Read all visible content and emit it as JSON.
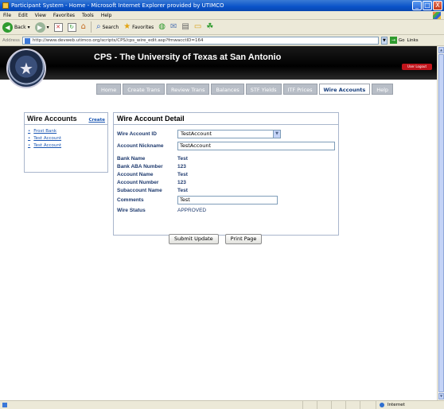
{
  "window": {
    "title": "Participant System - Home - Microsoft Internet Explorer provided by UTIMCO",
    "controls": [
      "_",
      "□",
      "X"
    ]
  },
  "menu": [
    "File",
    "Edit",
    "View",
    "Favorites",
    "Tools",
    "Help"
  ],
  "toolbar": {
    "back_label": "Back",
    "search_label": "Search",
    "favorites_label": "Favorites"
  },
  "address": {
    "label": "Address",
    "url": "http://www.devweb.utimco.org/scripts/CPS/cps_wire_edit.asp?fmwacctID=164",
    "go_label": "Go",
    "links_label": "Links"
  },
  "banner": {
    "title": "CPS - The University of Texas at San Antonio",
    "logout_label": "User Logout"
  },
  "tabs": [
    {
      "label": "Home"
    },
    {
      "label": "Create Trans"
    },
    {
      "label": "Review Trans"
    },
    {
      "label": "Balances"
    },
    {
      "label": "STF Yields"
    },
    {
      "label": "ITF Prices"
    },
    {
      "label": "Wire Accounts",
      "active": true
    },
    {
      "label": "Help"
    }
  ],
  "wire_accounts": {
    "title": "Wire Accounts",
    "create_label": "Create",
    "items": [
      "Frost Bank",
      "Test Account",
      "Test Account"
    ]
  },
  "detail": {
    "title": "Wire Account Detail",
    "wire_account_id_label": "Wire Account ID",
    "wire_account_id_value": "TestAccount",
    "nickname_label": "Account Nickname",
    "nickname_value": "TestAccount",
    "bank_name_label": "Bank Name",
    "bank_name_value": "Test",
    "aba_label": "Bank ABA Number",
    "aba_value": "123",
    "account_name_label": "Account Name",
    "account_name_value": "Test",
    "account_number_label": "Account Number",
    "account_number_value": "123",
    "subaccount_label": "Subaccount Name",
    "subaccount_value": "Test",
    "comments_label": "Comments",
    "comments_value": "Test",
    "status_label": "Wire Status",
    "status_value": "APPROVED"
  },
  "buttons": {
    "submit_label": "Submit Update",
    "print_label": "Print Page"
  },
  "status": {
    "zone": "Internet"
  }
}
